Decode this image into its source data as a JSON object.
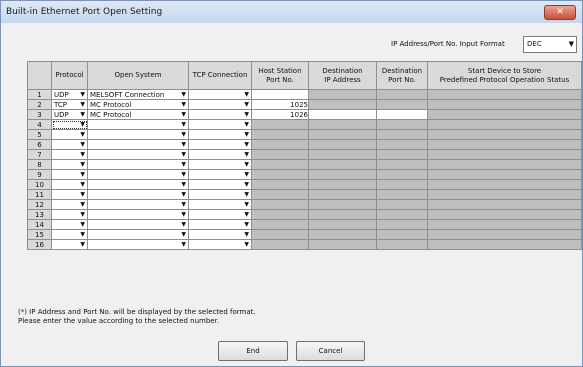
{
  "window": {
    "title": "Built-in Ethernet Port Open Setting",
    "close_icon": "close-icon (×)"
  },
  "ip_format": {
    "label": "IP Address/Port No. Input Format",
    "value": "DEC"
  },
  "table": {
    "headers": [
      "",
      "Protocol",
      "Open System",
      "TCP Connection",
      "Host Station\nPort No.",
      "Destination\nIP Address",
      "Destination\nPort No.",
      "Start Device to Store\nPredefined Protocol Operation Status"
    ],
    "rows": [
      {
        "num": "1",
        "protocol": "UDP",
        "open_system": "MELSOFT Connection",
        "tcp": "",
        "host_port": "",
        "dest_ip_state": "gray",
        "dest_port_state": "gray",
        "start_state": "gray"
      },
      {
        "num": "2",
        "protocol": "TCP",
        "open_system": "MC Protocol",
        "tcp": "",
        "host_port": "1025",
        "dest_ip_state": "gray",
        "dest_port_state": "gray",
        "start_state": "gray"
      },
      {
        "num": "3",
        "protocol": "UDP",
        "open_system": "MC Protocol",
        "tcp": "",
        "host_port": "1026",
        "dest_ip_state": "white",
        "dest_port_state": "white",
        "start_state": "gray"
      },
      {
        "num": "4",
        "protocol": "",
        "open_system": "",
        "tcp": "",
        "host_port": "",
        "dest_ip_state": "gray",
        "dest_port_state": "gray",
        "start_state": "gray"
      },
      {
        "num": "5",
        "protocol": "",
        "open_system": "",
        "tcp": "",
        "host_port": "",
        "dest_ip_state": "gray",
        "dest_port_state": "gray",
        "start_state": "gray"
      },
      {
        "num": "6",
        "protocol": "",
        "open_system": "",
        "tcp": "",
        "host_port": "",
        "dest_ip_state": "gray",
        "dest_port_state": "gray",
        "start_state": "gray"
      },
      {
        "num": "7",
        "protocol": "",
        "open_system": "",
        "tcp": "",
        "host_port": "",
        "dest_ip_state": "gray",
        "dest_port_state": "gray",
        "start_state": "gray"
      },
      {
        "num": "8",
        "protocol": "",
        "open_system": "",
        "tcp": "",
        "host_port": "",
        "dest_ip_state": "gray",
        "dest_port_state": "gray",
        "start_state": "gray"
      },
      {
        "num": "9",
        "protocol": "",
        "open_system": "",
        "tcp": "",
        "host_port": "",
        "dest_ip_state": "gray",
        "dest_port_state": "gray",
        "start_state": "gray"
      },
      {
        "num": "10",
        "protocol": "",
        "open_system": "",
        "tcp": "",
        "host_port": "",
        "dest_ip_state": "gray",
        "dest_port_state": "gray",
        "start_state": "gray"
      },
      {
        "num": "11",
        "protocol": "",
        "open_system": "",
        "tcp": "",
        "host_port": "",
        "dest_ip_state": "gray",
        "dest_port_state": "gray",
        "start_state": "gray"
      },
      {
        "num": "12",
        "protocol": "",
        "open_system": "",
        "tcp": "",
        "host_port": "",
        "dest_ip_state": "gray",
        "dest_port_state": "gray",
        "start_state": "gray"
      },
      {
        "num": "13",
        "protocol": "",
        "open_system": "",
        "tcp": "",
        "host_port": "",
        "dest_ip_state": "gray",
        "dest_port_state": "gray",
        "start_state": "gray"
      },
      {
        "num": "14",
        "protocol": "",
        "open_system": "",
        "tcp": "",
        "host_port": "",
        "dest_ip_state": "gray",
        "dest_port_state": "gray",
        "start_state": "gray"
      },
      {
        "num": "15",
        "protocol": "",
        "open_system": "",
        "tcp": "",
        "host_port": "",
        "dest_ip_state": "gray",
        "dest_port_state": "gray",
        "start_state": "gray"
      },
      {
        "num": "16",
        "protocol": "",
        "open_system": "",
        "tcp": "",
        "host_port": "",
        "dest_ip_state": "gray",
        "dest_port_state": "gray",
        "start_state": "gray"
      }
    ]
  },
  "note": {
    "line1": "(*) IP Address and Port No. will be displayed by the selected format.",
    "line2": "Please enter the value according to the selected number."
  },
  "buttons": {
    "end": "End",
    "cancel": "Cancel"
  },
  "icons": {
    "dropdown": "▼",
    "close": "✕"
  }
}
